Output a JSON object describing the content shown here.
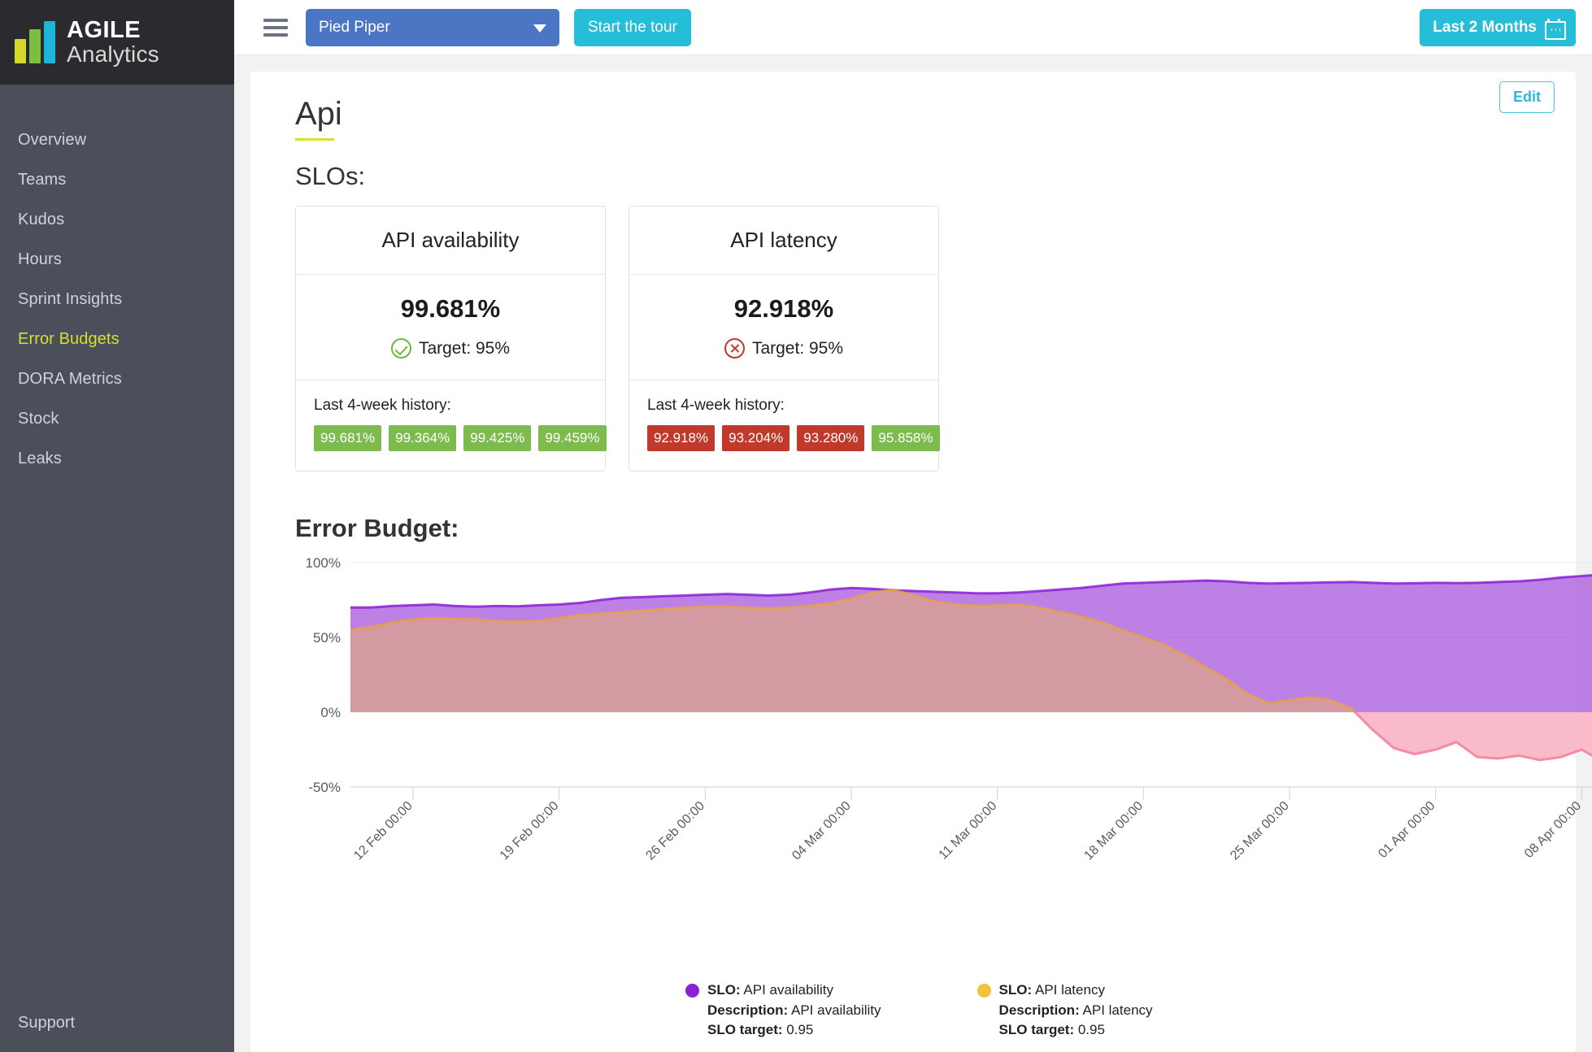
{
  "brand": {
    "line1": "AGILE",
    "line2": "Analytics"
  },
  "sidebar": {
    "items": [
      {
        "label": "Overview"
      },
      {
        "label": "Teams"
      },
      {
        "label": "Kudos"
      },
      {
        "label": "Hours"
      },
      {
        "label": "Sprint Insights"
      },
      {
        "label": "Error Budgets"
      },
      {
        "label": "DORA Metrics"
      },
      {
        "label": "Stock"
      },
      {
        "label": "Leaks"
      }
    ],
    "active_index": 5,
    "support_label": "Support"
  },
  "topbar": {
    "project_select": "Pied Piper",
    "tour_button": "Start the tour",
    "date_range_button": "Last 2 Months"
  },
  "page": {
    "title": "Api",
    "edit_button": "Edit",
    "slos_heading": "SLOs:",
    "error_budget_heading": "Error Budget:"
  },
  "slo_cards": [
    {
      "name": "API availability",
      "value": "99.681%",
      "target": "Target: 95%",
      "status": "ok",
      "history_label": "Last 4-week history:",
      "history": [
        {
          "value": "99.681%",
          "state": "good"
        },
        {
          "value": "99.364%",
          "state": "good"
        },
        {
          "value": "99.425%",
          "state": "good"
        },
        {
          "value": "99.459%",
          "state": "good"
        }
      ]
    },
    {
      "name": "API latency",
      "value": "92.918%",
      "target": "Target: 95%",
      "status": "bad",
      "history_label": "Last 4-week history:",
      "history": [
        {
          "value": "92.918%",
          "state": "bad"
        },
        {
          "value": "93.204%",
          "state": "bad"
        },
        {
          "value": "93.280%",
          "state": "bad"
        },
        {
          "value": "95.858%",
          "state": "good"
        }
      ]
    }
  ],
  "legend": [
    {
      "color": "#8b1fd6",
      "slo_key": "SLO:",
      "slo_value": "API availability",
      "desc_key": "Description:",
      "desc_value": "API availability",
      "target_key": "SLO target:",
      "target_value": "0.95"
    },
    {
      "color": "#f2c139",
      "slo_key": "SLO:",
      "slo_value": "API latency",
      "desc_key": "Description:",
      "desc_value": "API latency",
      "target_key": "SLO target:",
      "target_value": "0.95"
    }
  ],
  "chart_data": {
    "type": "area",
    "title": "Error Budget:",
    "xlabel": "",
    "ylabel": "",
    "ylim": [
      -50,
      100
    ],
    "yticks": [
      "100%",
      "50%",
      "0%",
      "-50%"
    ],
    "ytick_values": [
      100,
      50,
      0,
      -50
    ],
    "grid": true,
    "legend_position": "bottom",
    "xtick_labels": [
      "12 Feb 00:00",
      "19 Feb 00:00",
      "26 Feb 00:00",
      "04 Mar 00:00",
      "11 Mar 00:00",
      "18 Mar 00:00",
      "25 Mar 00:00",
      "01 Apr 00:00",
      "08 Apr 00:00"
    ],
    "xtick_index": [
      3,
      10,
      17,
      24,
      31,
      38,
      45,
      52,
      59
    ],
    "series": [
      {
        "name": "API availability",
        "color": "#8b1fd6",
        "fill": "#b26ae0",
        "values": [
          70,
          70,
          71,
          71.5,
          72,
          71,
          70.5,
          71,
          70.8,
          71.5,
          72,
          73,
          75,
          76.5,
          77,
          77.5,
          78,
          78.5,
          79,
          78.5,
          78,
          78.5,
          80,
          82,
          83,
          82.5,
          81.5,
          81,
          80.5,
          80,
          79.5,
          79.5,
          80,
          81,
          82,
          83,
          84.5,
          86,
          86.5,
          87,
          87.5,
          88,
          87.5,
          86.5,
          86,
          86.3,
          86.5,
          86.8,
          87,
          86.5,
          86,
          86.2,
          86.5,
          86.3,
          86.5,
          87,
          87.5,
          88.5,
          90,
          91,
          92
        ]
      },
      {
        "name": "API latency",
        "color": "#e8a33d",
        "fill": "#d9a093",
        "fill_negative": "#f9b6c6",
        "values": [
          55,
          57,
          60,
          62,
          63,
          62.5,
          62,
          61,
          60.5,
          61,
          63,
          65,
          66,
          67,
          68,
          69,
          70,
          70.5,
          70.5,
          70,
          69.5,
          70,
          71,
          73,
          76,
          80,
          82,
          78,
          74,
          72,
          71,
          71.5,
          72,
          70,
          67,
          64,
          60,
          55,
          50,
          45,
          38,
          30,
          22,
          12,
          6,
          8,
          10,
          8,
          2,
          -12,
          -24,
          -28,
          -25,
          -20,
          -30,
          -31,
          -29,
          -32,
          -30,
          -25,
          -33
        ]
      }
    ]
  }
}
